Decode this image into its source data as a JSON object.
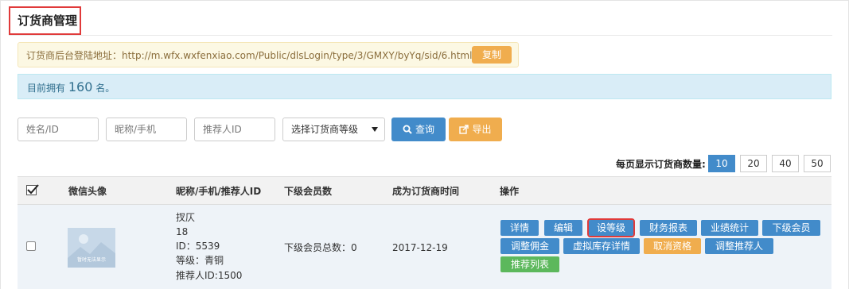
{
  "page": {
    "title": "订货商管理"
  },
  "notice": {
    "text": "订货商后台登陆地址：http://m.wfx.wxfenxiao.com/Public/dlsLogin/type/3/GMXY/byYq/sid/6.html",
    "copy_label": "复制"
  },
  "info": {
    "prefix": "目前拥有",
    "count": "160",
    "suffix": "名。"
  },
  "filters": {
    "name_placeholder": "姓名/ID",
    "nickname_placeholder": "昵称/手机",
    "referrer_placeholder": "推荐人ID",
    "level_select": "选择订货商等级",
    "search_label": "查询",
    "export_label": "导出"
  },
  "pager": {
    "label": "每页显示订货商数量:",
    "options": [
      "10",
      "20",
      "40",
      "50"
    ],
    "selected": "10"
  },
  "table": {
    "headers": {
      "avatar": "微信头像",
      "nickname": "昵称/手机/推荐人ID",
      "members": "下级会员数",
      "joined": "成为订货商时间",
      "ops": "操作"
    },
    "rows": [
      {
        "avatar_caption": "暂时无法显示",
        "name": "扠仄",
        "phone": "18",
        "id_line": "ID：5539",
        "level_line": "等级：青铜",
        "referrer_line": "推荐人ID:1500",
        "members": "下级会员总数：0",
        "joined": "2017-12-19",
        "ops": {
          "detail": "详情",
          "edit": "编辑",
          "set_level": "设等级",
          "finance": "财务报表",
          "performance": "业绩统计",
          "sub_members": "下级会员",
          "commission": "调整佣金",
          "inventory": "虚拟库存详情",
          "cancel": "取消资格",
          "referrer": "调整推荐人",
          "referrals": "推荐列表"
        }
      }
    ]
  },
  "colors": {
    "primary": "#428bca",
    "warning": "#f0ad4e",
    "success": "#5cb85c",
    "highlight": "#e03a3a"
  }
}
